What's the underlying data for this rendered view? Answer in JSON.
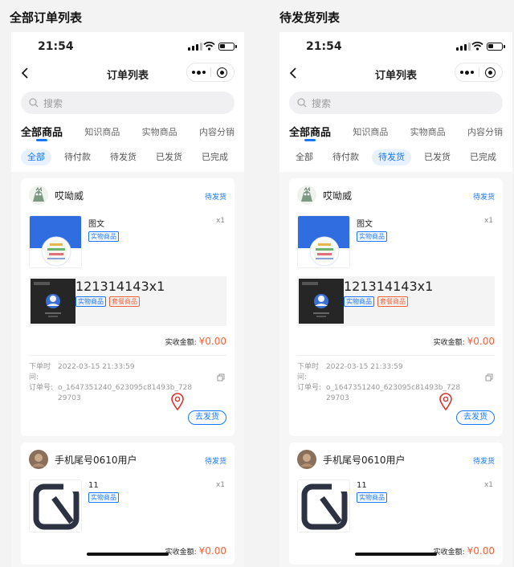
{
  "captions": {
    "left": "全部订单列表",
    "right": "待发货列表"
  },
  "phones": [
    {
      "status_time": "21:54",
      "nav_title": "订单列表",
      "search_placeholder": "搜索",
      "tabs": [
        "全部商品",
        "知识商品",
        "实物商品",
        "内容分销"
      ],
      "subtabs": [
        "全部",
        "待付款",
        "待发货",
        "已发货",
        "已完成"
      ],
      "active_subtab": 0,
      "orders": [
        {
          "shop": "哎呦威",
          "status": "待发货",
          "item": {
            "name": "图文",
            "qty": "x1",
            "tags": [
              "实物商品"
            ]
          },
          "bundle": {
            "name": "121314143",
            "qty": "x1",
            "tags": [
              "实物商品",
              "套餐商品"
            ]
          },
          "amount_label": "实收金额:",
          "amount_value": "¥0.00",
          "time_label": "下单时间:",
          "time_value": "2022-03-15 21:33:59",
          "no_label": "订单号:",
          "no_value": "o_1647351240_623095c81493b_72829703",
          "ship_button": "去发货"
        },
        {
          "shop": "手机尾号0610用户",
          "status": "待发货",
          "item": {
            "name": "11",
            "qty": "x1",
            "tags": [
              "实物商品"
            ]
          },
          "amount_label": "实收金额:",
          "amount_value": "¥0.00"
        }
      ]
    },
    {
      "status_time": "21:54",
      "nav_title": "订单列表",
      "search_placeholder": "搜索",
      "tabs": [
        "全部商品",
        "知识商品",
        "实物商品",
        "内容分销"
      ],
      "subtabs": [
        "全部",
        "待付款",
        "待发货",
        "已发货",
        "已完成"
      ],
      "active_subtab": 2,
      "orders": [
        {
          "shop": "哎呦威",
          "status": "待发货",
          "item": {
            "name": "图文",
            "qty": "x1",
            "tags": [
              "实物商品"
            ]
          },
          "bundle": {
            "name": "121314143",
            "qty": "x1",
            "tags": [
              "实物商品",
              "套餐商品"
            ]
          },
          "amount_label": "实收金额:",
          "amount_value": "¥0.00",
          "time_label": "下单时间:",
          "time_value": "2022-03-15 21:33:59",
          "no_label": "订单号:",
          "no_value": "o_1647351240_623095c81493b_72829703",
          "ship_button": "去发货"
        },
        {
          "shop": "手机尾号0610用户",
          "status": "待发货",
          "item": {
            "name": "11",
            "qty": "x1",
            "tags": [
              "实物商品"
            ]
          },
          "amount_label": "实收金额:",
          "amount_value": "¥0.00"
        }
      ]
    }
  ],
  "colors": {
    "accent": "#1677ff",
    "price": "#f0633a",
    "pin": "#d9342b"
  }
}
